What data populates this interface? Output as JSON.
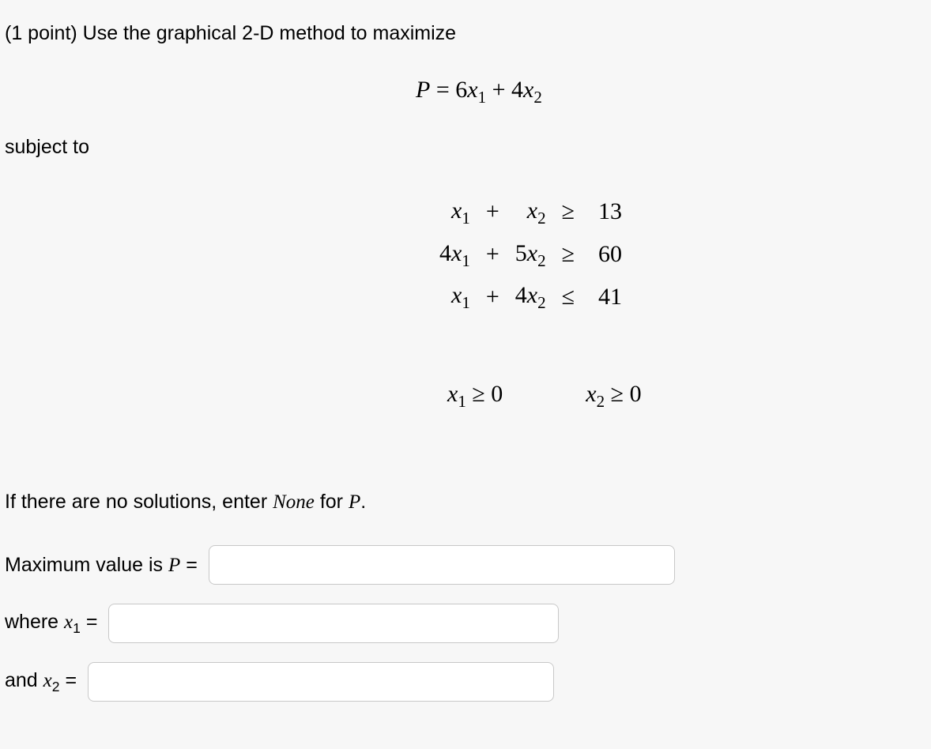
{
  "prompt_line": "(1 point) Use the graphical 2-D method to maximize",
  "objective_html": "<span class='mi'>P</span> = 6<span class='mi'>x</span><sub>1</sub> + 4<span class='mi'>x</span><sub>2</sub>",
  "subject_to": "subject to",
  "constraints": [
    {
      "c1": "<span class='mi'>x</span><sub>1</sub>",
      "op1": "+",
      "c2": "<span class='mi'>x</span><sub>2</sub>",
      "rel": "≥",
      "rhs": "13"
    },
    {
      "c1": "4<span class='mi'>x</span><sub>1</sub>",
      "op1": "+",
      "c2": "5<span class='mi'>x</span><sub>2</sub>",
      "rel": "≥",
      "rhs": "60"
    },
    {
      "c1": "<span class='mi'>x</span><sub>1</sub>",
      "op1": "+",
      "c2": "4<span class='mi'>x</span><sub>2</sub>",
      "rel": "≤",
      "rhs": "41"
    }
  ],
  "nonneg1": "<span class='mi'>x</span><sub>1</sub> ≥ 0",
  "nonneg2": "<span class='mi'>x</span><sub>2</sub> ≥ 0",
  "instruction_html": "If there are no solutions, enter <span class='ivar'>None</span> for <span class='ivar'>P</span>.",
  "answers": {
    "max_label_html": "Maximum value is <span class='mvar'>P</span> =",
    "x1_label_html": "where <span class='mvar'>x</span><sub>1</sub> =",
    "x2_label_html": "and <span class='mvar'>x</span><sub>2</sub> =",
    "p_value": "",
    "x1_value": "",
    "x2_value": ""
  }
}
